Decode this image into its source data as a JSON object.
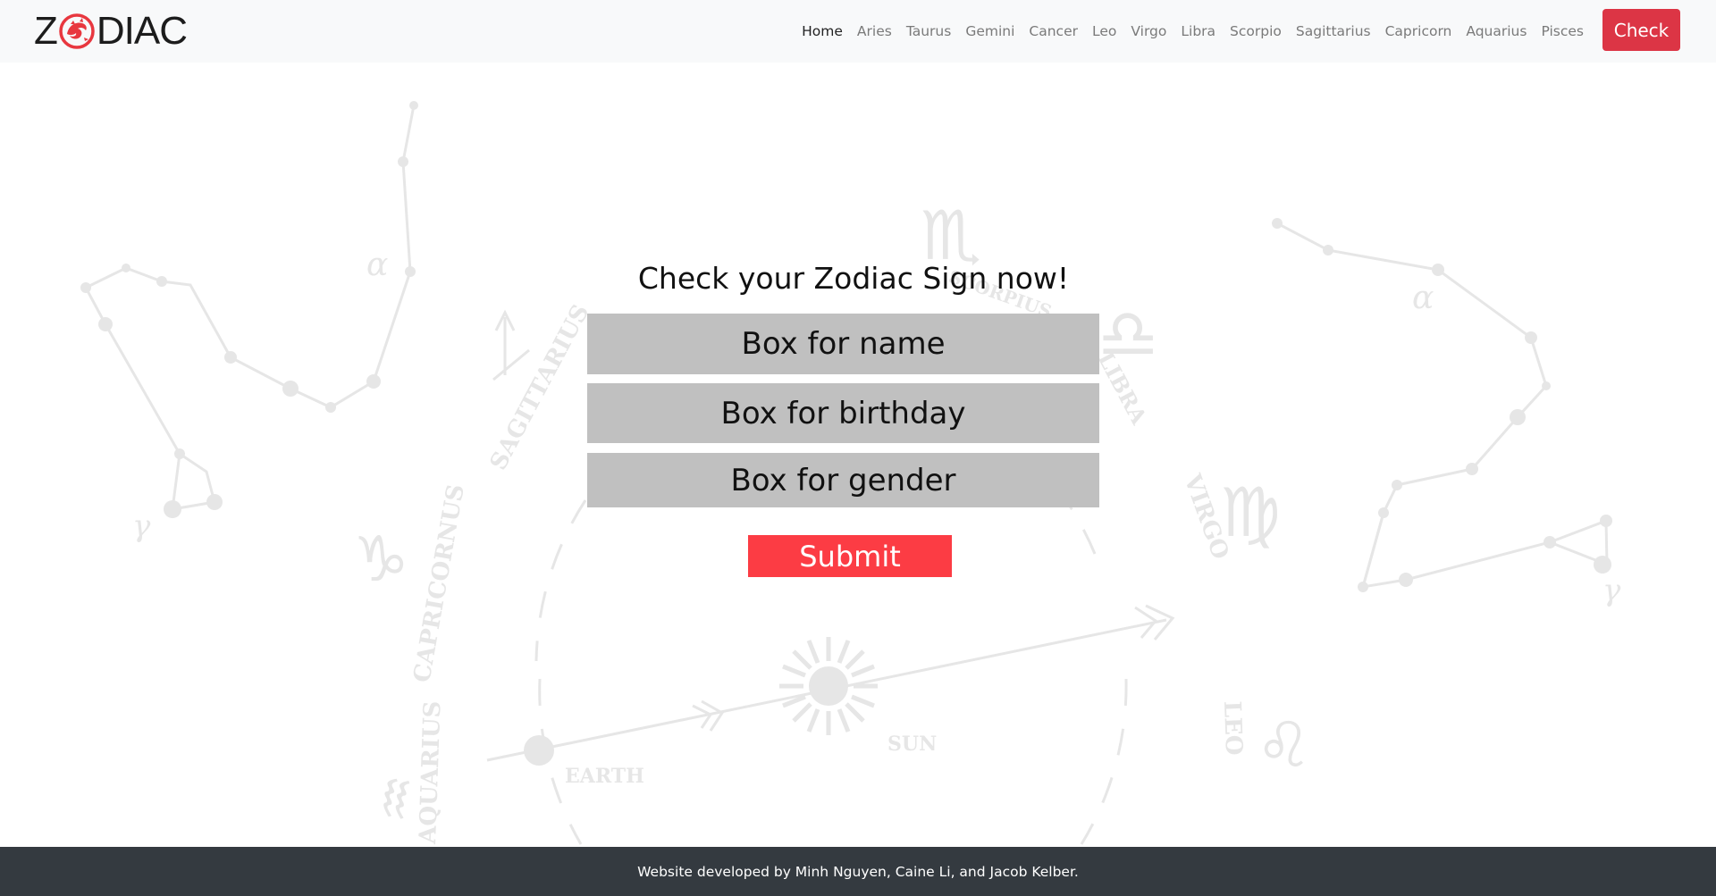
{
  "brand": {
    "text_before": "Z",
    "text_after": "DIAC",
    "logo_icon": "red-dragon-emblem-icon",
    "logo_color": "#e8373f"
  },
  "nav": {
    "items": [
      {
        "label": "Home",
        "active": true
      },
      {
        "label": "Aries"
      },
      {
        "label": "Taurus"
      },
      {
        "label": "Gemini"
      },
      {
        "label": "Cancer"
      },
      {
        "label": "Leo"
      },
      {
        "label": "Virgo"
      },
      {
        "label": "Libra"
      },
      {
        "label": "Scorpio"
      },
      {
        "label": "Sagittarius"
      },
      {
        "label": "Capricorn"
      },
      {
        "label": "Aquarius"
      },
      {
        "label": "Pisces"
      }
    ],
    "check_label": "Check",
    "check_color": "#dc3545"
  },
  "background": {
    "labels": {
      "sagittarius": "SAGITTARIUS",
      "capricornus": "CAPRICORNUS",
      "aquarius": "AQUARIUS",
      "virgo": "VIRGO",
      "leo": "LEO",
      "libra": "LIBRA",
      "scorpius": "SCORPIUS",
      "sun": "SUN",
      "earth": "EARTH"
    },
    "greek": {
      "alpha": "α",
      "gamma": "γ",
      "alpha2": "α",
      "gamma2": "γ"
    },
    "symbols": {
      "scorpio": "♏",
      "virgo": "♍",
      "leo": "♌",
      "capricorn": "♑",
      "libra": "♎",
      "aquarius": "♒"
    },
    "art_color": "#e6e6e6"
  },
  "form": {
    "title": "Check your Zodiac Sign now!",
    "name_placeholder": "Box for name",
    "birthday_placeholder": "Box for birthday",
    "gender_placeholder": "Box for gender",
    "submit_label": "Submit",
    "field_color": "#c0c0c0",
    "submit_color": "#fc3c44"
  },
  "footer": {
    "text": "Website developed by Minh Nguyen, Caine Li, and Jacob Kelber."
  }
}
